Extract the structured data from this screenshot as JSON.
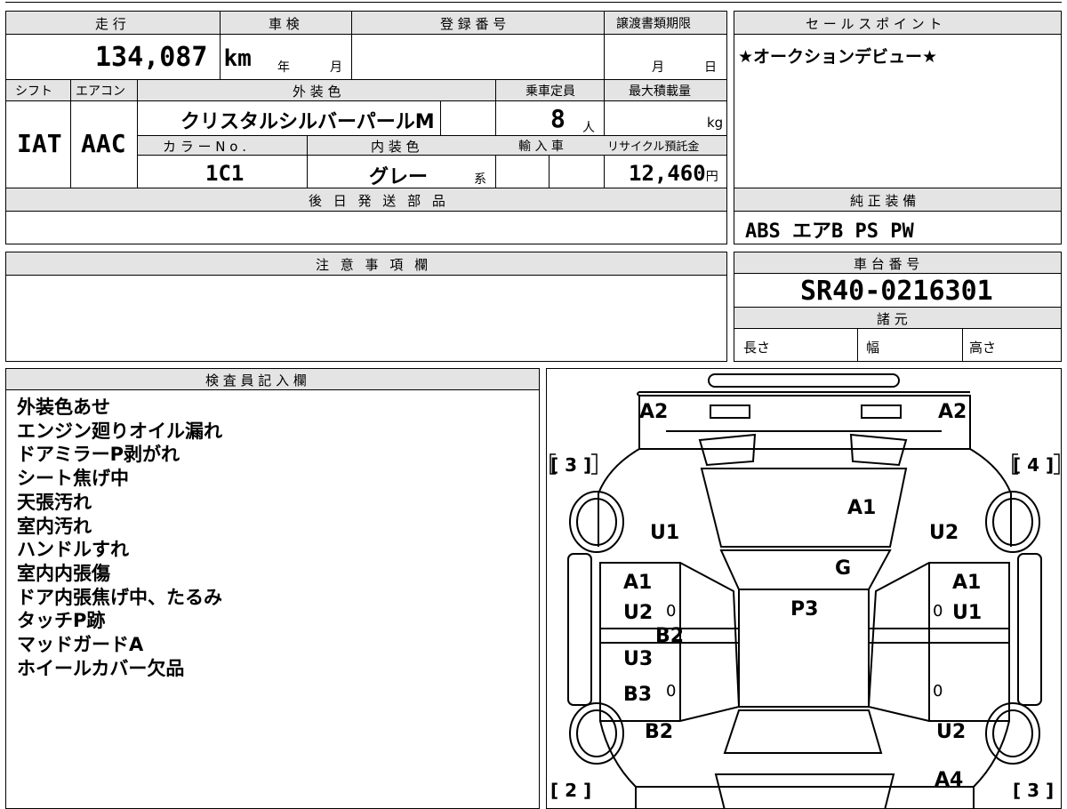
{
  "mileage": {
    "label": "走 行",
    "value": "134,087",
    "unit": "km"
  },
  "shaken": {
    "label": "車 検",
    "year": "年",
    "month": "月"
  },
  "registration": {
    "label": "登 録 番 号",
    "value": ""
  },
  "transfer_deadline": {
    "label": "譲渡書類期限",
    "month": "月",
    "day": "日"
  },
  "shift": {
    "label": "シフト",
    "value": "IAT"
  },
  "aircon": {
    "label": "エアコン",
    "value": "AAC"
  },
  "exterior_color": {
    "label": "外 装 色",
    "value": "クリスタルシルバーパールM"
  },
  "capacity": {
    "label": "乗車定員",
    "value": "8",
    "unit": "人"
  },
  "max_load": {
    "label": "最大積載量",
    "value": "",
    "unit": "kg"
  },
  "color_no": {
    "label": "カ ラ ー N o .",
    "value": "1C1"
  },
  "interior_color": {
    "label": "内 装 色",
    "value": "グレー",
    "suffix": "系"
  },
  "import": {
    "label": "輸 入 車"
  },
  "recycle_fee": {
    "label": "リサイクル預託金",
    "value": "12,460",
    "unit": "円"
  },
  "later_parts": {
    "label": "後 日 発 送 部 品",
    "value": ""
  },
  "sales_point": {
    "label": "セ ー ル ス ポ イ ン ト",
    "value": "★オークションデビュー★"
  },
  "genuine_equipment": {
    "label": "純 正 装 備",
    "value": "ABS エアB PS PW"
  },
  "notes": {
    "label": "注 意 事 項 欄",
    "value": ""
  },
  "chassis_no": {
    "label": "車 台 番 号",
    "value": "SR40-0216301"
  },
  "specs": {
    "label": "諸 元",
    "length": "長さ",
    "width": "幅",
    "height": "高さ"
  },
  "inspector": {
    "label": "検 査 員 記 入 欄",
    "notes": [
      "外装色あせ",
      "エンジン廻りオイル漏れ",
      "ドアミラーP剥がれ",
      "シート焦げ中",
      "天張汚れ",
      "室内汚れ",
      "ハンドルすれ",
      "室内内張傷",
      "ドア内張焦げ中、たるみ",
      "タッチP跡",
      "マッドガードA",
      "ホイールカバー欠品"
    ]
  },
  "diagram": {
    "marks": {
      "front_left": "A2",
      "front_right": "A2",
      "hood": "A1",
      "fender_left": "U1",
      "fender_right": "U2",
      "windshield": "G",
      "roof": "P3",
      "door_fl_1": "A1",
      "door_fl_2": "U2",
      "door_fl_zero": "0",
      "pillar_left": "B2",
      "door_rl_1": "U3",
      "door_rl_2": "B3",
      "door_rl_zero": "0",
      "door_fr_1": "A1",
      "door_fr_2": "U1",
      "door_fr_zero": "0",
      "door_rr_zero": "0",
      "rear_quarter_left": "B2",
      "rear_quarter_right": "U2",
      "rear_right": "A4"
    },
    "tire_labels": {
      "front_left": "[ 3 ]",
      "front_right": "[ 4 ]",
      "rear_left": "[ 2 ]",
      "rear_right": "[ 3 ]"
    }
  }
}
